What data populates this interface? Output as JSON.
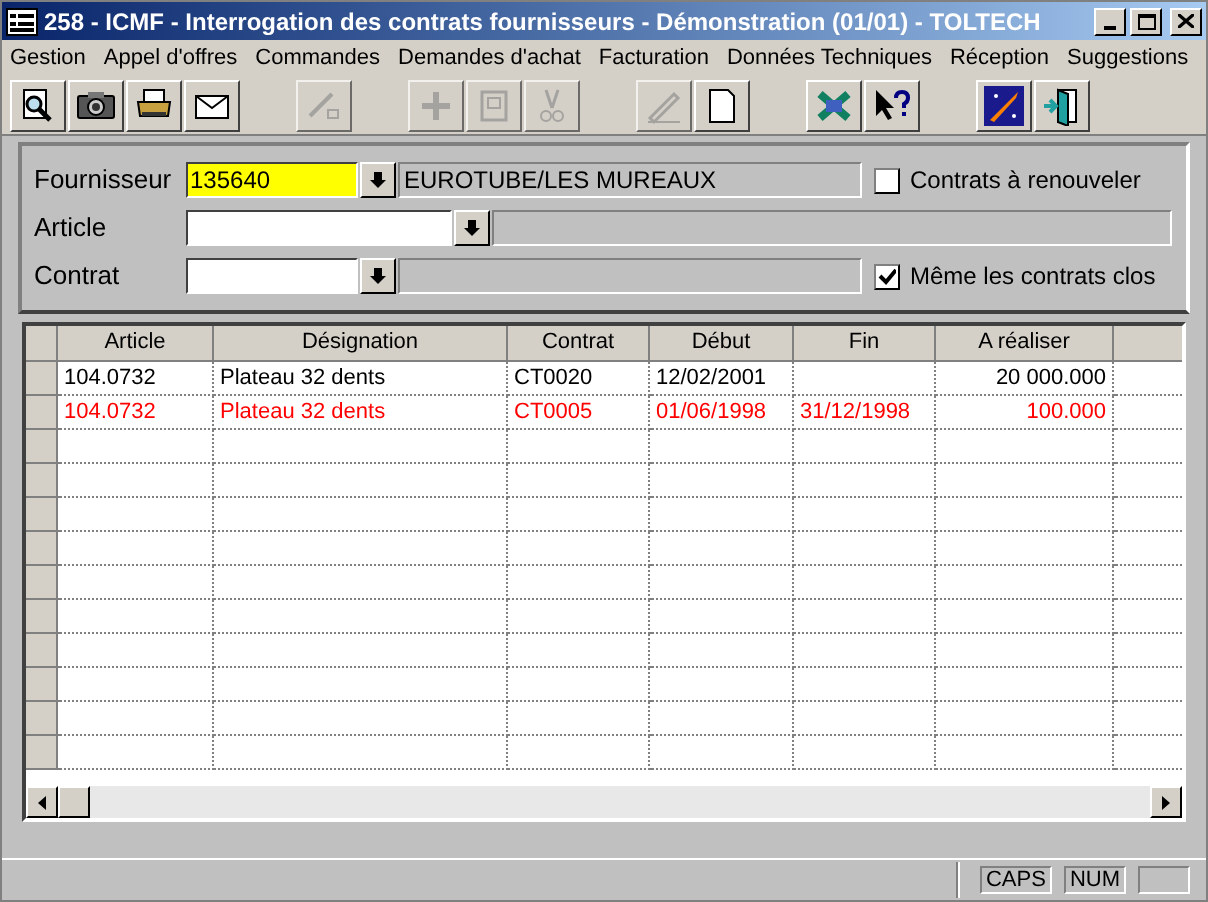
{
  "window": {
    "title": "258 - ICMF - Interrogation des contrats fournisseurs - Démonstration (01/01) - TOLTECH"
  },
  "menu": [
    "Gestion",
    "Appel d'offres",
    "Commandes",
    "Demandes d'achat",
    "Facturation",
    "Données Techniques",
    "Réception",
    "Suggestions"
  ],
  "toolbar_groups": [
    [
      {
        "kind": "preview",
        "disabled": false
      },
      {
        "kind": "camera",
        "disabled": false
      },
      {
        "kind": "printer",
        "disabled": false
      },
      {
        "kind": "mail",
        "disabled": false
      }
    ],
    [
      {
        "kind": "edit",
        "disabled": true
      }
    ],
    [
      {
        "kind": "add",
        "disabled": true
      },
      {
        "kind": "square",
        "disabled": true
      },
      {
        "kind": "cut",
        "disabled": true
      }
    ],
    [
      {
        "kind": "pencil",
        "disabled": true
      },
      {
        "kind": "page",
        "disabled": false
      }
    ],
    [
      {
        "kind": "spreadsheet",
        "disabled": false
      },
      {
        "kind": "help",
        "disabled": false
      }
    ],
    [
      {
        "kind": "rocket",
        "disabled": false
      },
      {
        "kind": "exit",
        "disabled": false
      }
    ]
  ],
  "form": {
    "fournisseur": {
      "label": "Fournisseur",
      "value": "135640",
      "name": "EUROTUBE/LES MUREAUX"
    },
    "article": {
      "label": "Article"
    },
    "contrat": {
      "label": "Contrat"
    },
    "renouveler": {
      "label": "Contrats à renouveler",
      "checked": false
    },
    "clos": {
      "label": "Même les contrats clos",
      "checked": true
    }
  },
  "table": {
    "columns": [
      "Article",
      "Désignation",
      "Contrat",
      "Début",
      "Fin",
      "A réaliser"
    ],
    "rows": [
      {
        "closed": false,
        "cells": [
          "104.0732",
          "Plateau 32 dents",
          "CT0020",
          "12/02/2001",
          "",
          "20 000.000"
        ]
      },
      {
        "closed": true,
        "cells": [
          "104.0732",
          "Plateau 32 dents",
          "CT0005",
          "01/06/1998",
          "31/12/1998",
          "100.000"
        ]
      }
    ]
  },
  "status_bar": [
    "CAPS",
    "NUM"
  ]
}
